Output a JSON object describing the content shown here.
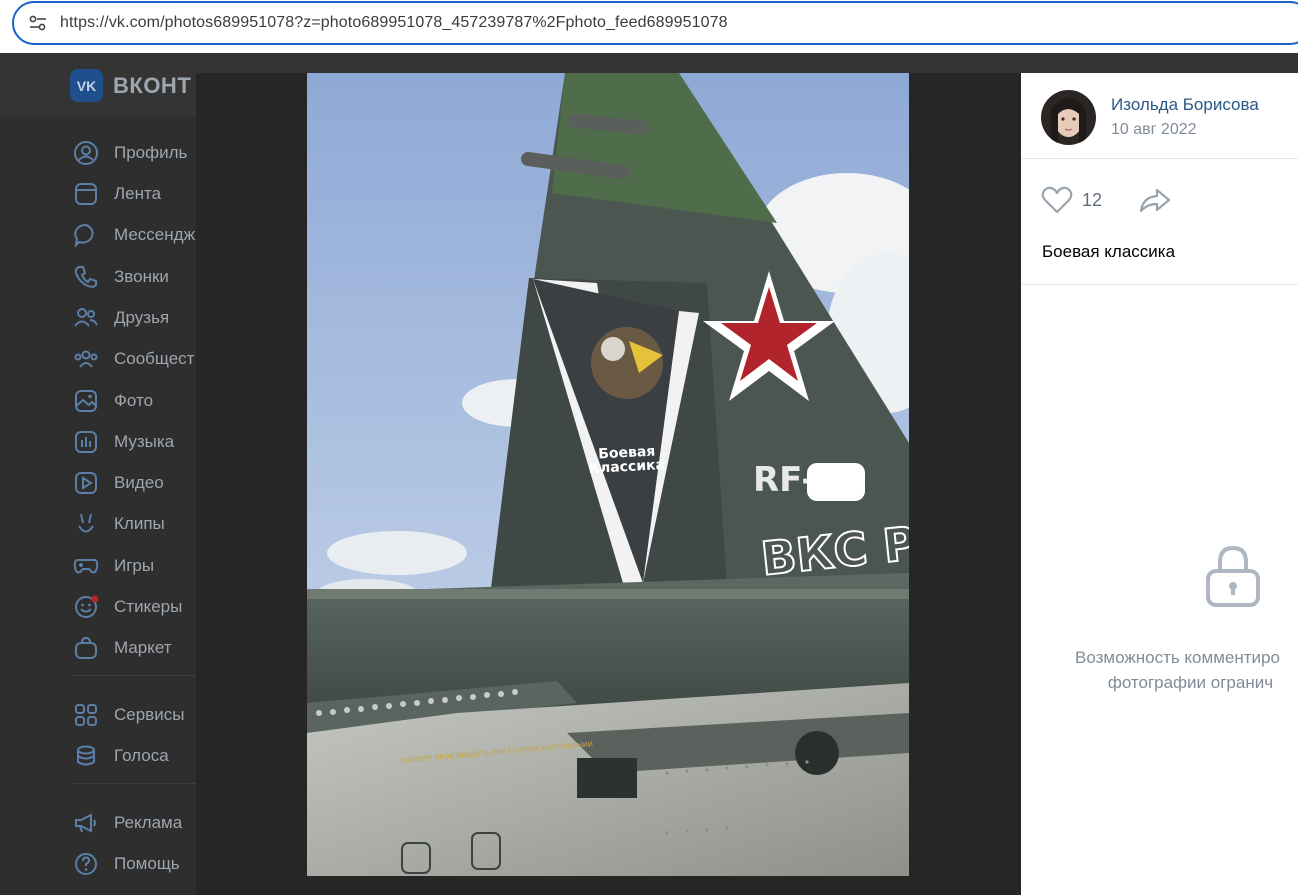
{
  "browser": {
    "url": "https://vk.com/photos689951078?z=photo689951078_457239787%2Fphoto_feed689951078"
  },
  "vk": {
    "logo_text": "ВКОНТ",
    "nav": [
      {
        "label": "Профиль",
        "icon": "profile-icon"
      },
      {
        "label": "Лента",
        "icon": "feed-icon"
      },
      {
        "label": "Мессендж",
        "icon": "messenger-icon"
      },
      {
        "label": "Звонки",
        "icon": "calls-icon"
      },
      {
        "label": "Друзья",
        "icon": "friends-icon"
      },
      {
        "label": "Сообщест",
        "icon": "communities-icon"
      },
      {
        "label": "Фото",
        "icon": "photo-icon"
      },
      {
        "label": "Музыка",
        "icon": "music-icon"
      },
      {
        "label": "Видео",
        "icon": "video-icon"
      },
      {
        "label": "Клипы",
        "icon": "clips-icon"
      },
      {
        "label": "Игры",
        "icon": "games-icon"
      },
      {
        "label": "Стикеры",
        "icon": "stickers-icon"
      },
      {
        "label": "Маркет",
        "icon": "market-icon"
      },
      {
        "label": "Сервисы",
        "icon": "services-icon"
      },
      {
        "label": "Голоса",
        "icon": "votes-icon"
      },
      {
        "label": "Реклама",
        "icon": "ads-icon"
      },
      {
        "label": "Помощь",
        "icon": "help-icon"
      }
    ]
  },
  "viewer": {
    "photo": {
      "subject": "Su-25 tail fin with red star",
      "text_on_photo": {
        "fin_label": "Боевая Классика",
        "registration": "RF-",
        "side_text": "ВКС РОСС"
      }
    },
    "author": {
      "name": "Изольда Борисова",
      "date": "10 авг 2022"
    },
    "likes": "12",
    "caption": "Боевая классика",
    "comments_note_line1": "Возможность комментиро",
    "comments_note_line2": "фотографии огранич"
  },
  "colors": {
    "accent": "#2a5885",
    "url_border": "#1a61c7",
    "muted": "#818c99"
  }
}
